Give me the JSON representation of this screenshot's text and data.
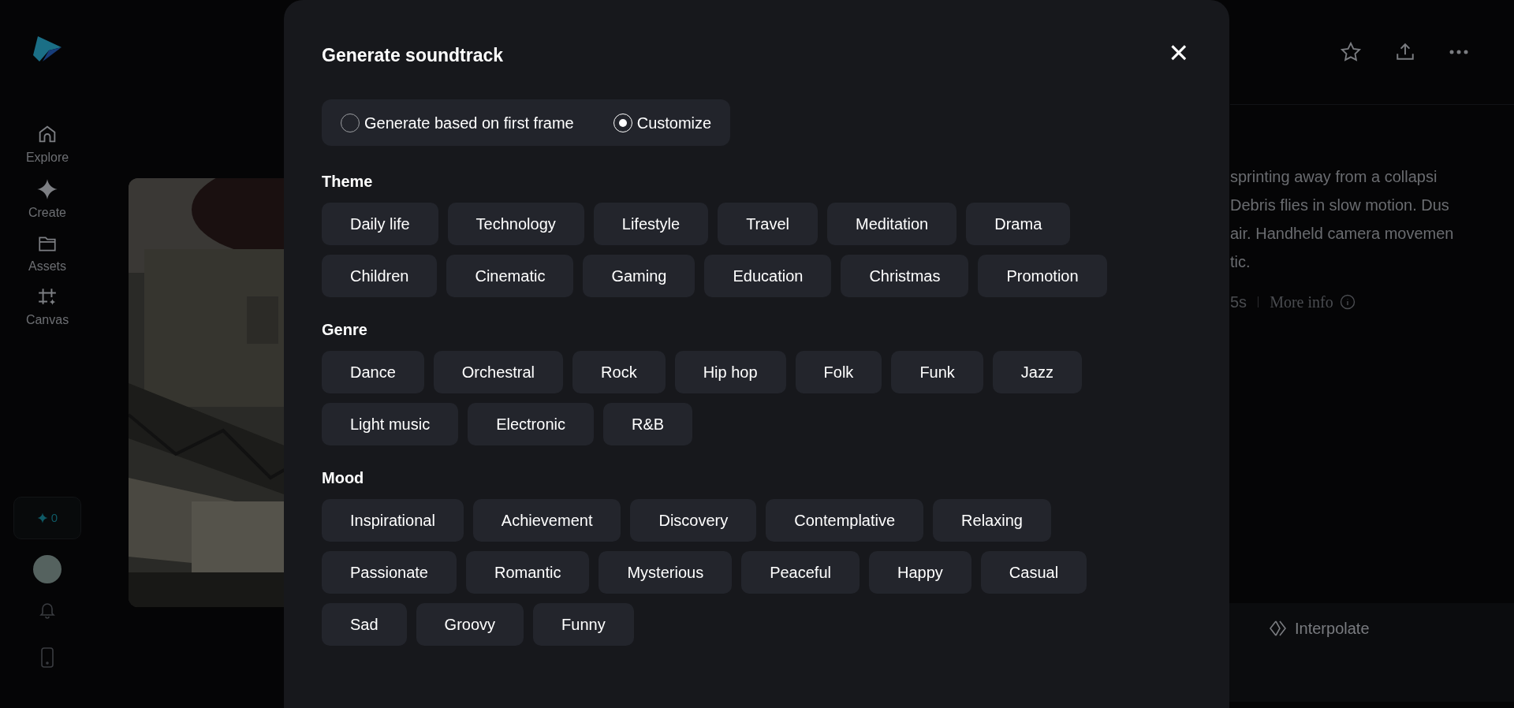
{
  "sidebar": {
    "nav": [
      {
        "label": "Explore"
      },
      {
        "label": "Create"
      },
      {
        "label": "Assets"
      },
      {
        "label": "Canvas"
      }
    ],
    "credits": "0"
  },
  "detail": {
    "prompt_lines": [
      "sprinting away from a collapsi",
      "Debris flies in slow motion. Dus",
      "air. Handheld camera movemen",
      "tic."
    ],
    "duration": "5s",
    "more_info": "More info",
    "interpolate": "Interpolate"
  },
  "modal": {
    "title": "Generate soundtrack",
    "close": "×",
    "modes": [
      {
        "label": "Generate based on first frame",
        "selected": false
      },
      {
        "label": "Customize",
        "selected": true
      }
    ],
    "sections": [
      {
        "title": "Theme",
        "rows": [
          [
            "Daily life",
            "Technology",
            "Lifestyle",
            "Travel",
            "Meditation",
            "Drama"
          ],
          [
            "Children",
            "Cinematic",
            "Gaming",
            "Education",
            "Christmas",
            "Promotion"
          ]
        ]
      },
      {
        "title": "Genre",
        "rows": [
          [
            "Dance",
            "Orchestral",
            "Rock",
            "Hip hop",
            "Folk",
            "Funk",
            "Jazz"
          ],
          [
            "Light music",
            "Electronic",
            "R&B"
          ]
        ]
      },
      {
        "title": "Mood",
        "rows": [
          [
            "Inspirational",
            "Achievement",
            "Discovery",
            "Contemplative",
            "Relaxing"
          ],
          [
            "Passionate",
            "Romantic",
            "Mysterious",
            "Peaceful",
            "Happy",
            "Casual"
          ],
          [
            "Sad",
            "Groovy",
            "Funny"
          ]
        ]
      }
    ]
  }
}
